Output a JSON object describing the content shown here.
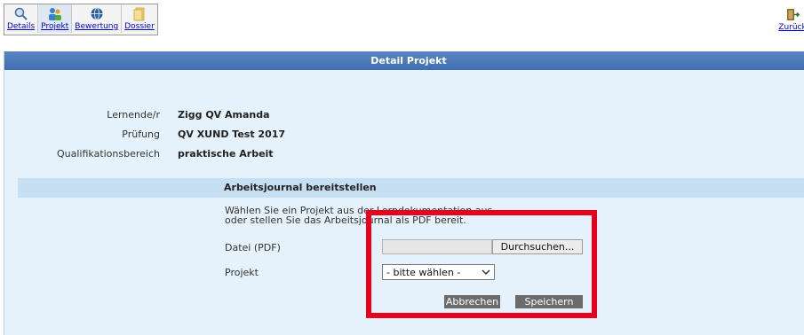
{
  "toolbar": {
    "items": [
      {
        "label": "Details",
        "icon": "magnifier-icon"
      },
      {
        "label": "Projekt",
        "icon": "people-icon"
      },
      {
        "label": "Bewertung",
        "icon": "globe-icon"
      },
      {
        "label": "Dossier",
        "icon": "folder-icon"
      }
    ],
    "back_label": "Zurück"
  },
  "panel": {
    "title": "Detail Projekt",
    "info": [
      {
        "label": "Lernende/r",
        "value": "Zigg QV Amanda"
      },
      {
        "label": "Prüfung",
        "value": "QV XUND Test 2017"
      },
      {
        "label": "Qualifikationsbereich",
        "value": "praktische Arbeit"
      }
    ]
  },
  "section": {
    "title": "Arbeitsjournal bereitstellen",
    "desc_line1": "Wählen Sie ein Projekt aus der Lerndokumentation aus",
    "desc_line2": "oder stellen Sie das Arbeitsjournal als PDF bereit.",
    "file_label": "Datei (PDF)",
    "browse_label": "Durchsuchen...",
    "project_label": "Projekt",
    "project_value": "- bitte wählen -",
    "cancel_label": "Abbrechen",
    "save_label": "Speichern"
  },
  "colors": {
    "header": "#4a77b9",
    "panel": "#e5f1fb",
    "section": "#c7dff2",
    "highlight": "#e6001e"
  }
}
